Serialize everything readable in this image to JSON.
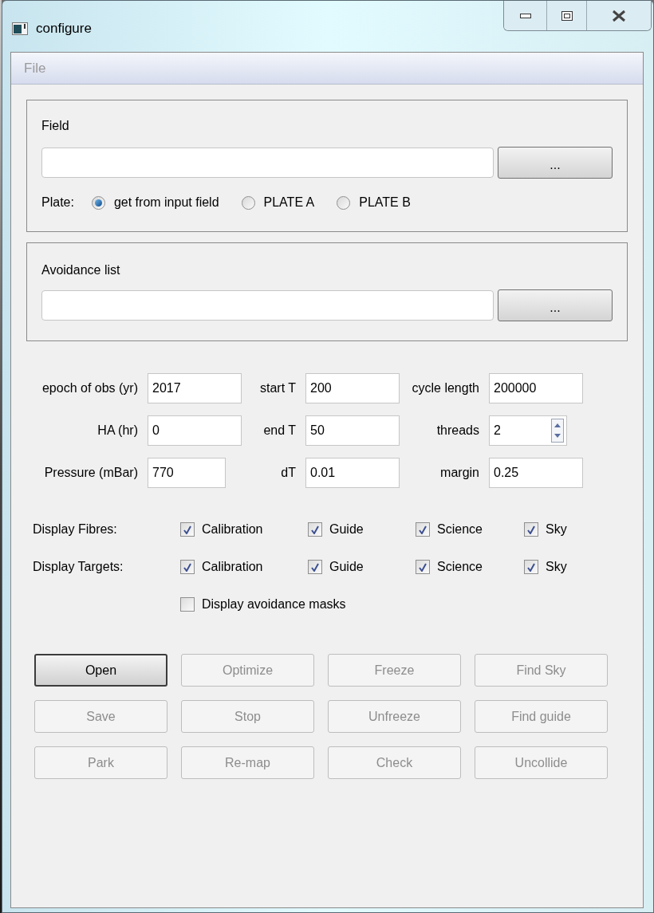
{
  "window": {
    "title": "configure"
  },
  "menu": [
    {
      "label": "File",
      "disabled": true
    }
  ],
  "field_group": {
    "title": "Field",
    "browse_button": "...",
    "plate": {
      "label": "Plate:",
      "options": [
        {
          "label": "get from input field",
          "selected": true
        },
        {
          "label": "PLATE A",
          "selected": false
        },
        {
          "label": "PLATE B",
          "selected": false
        }
      ]
    }
  },
  "avoidance_group": {
    "title": "Avoidance list",
    "browse_button": "..."
  },
  "parameters": [
    [
      {
        "label": "epoch of obs (yr)",
        "value": "2017",
        "kind": "text"
      },
      {
        "label": "start T",
        "value": "200",
        "kind": "text"
      },
      {
        "label": "cycle length",
        "value": "200000",
        "kind": "text"
      }
    ],
    [
      {
        "label": "HA (hr)",
        "value": "0",
        "kind": "text"
      },
      {
        "label": "end T",
        "value": "50",
        "kind": "text"
      },
      {
        "label": "threads",
        "value": "2",
        "kind": "spin"
      }
    ],
    [
      {
        "label": "Pressure (mBar)",
        "value": "770",
        "kind": "short"
      },
      {
        "label": "dT",
        "value": "0.01",
        "kind": "text"
      },
      {
        "label": "margin",
        "value": "0.25",
        "kind": "text"
      }
    ]
  ],
  "display_rows": [
    {
      "label": "Display Fibres:",
      "options": [
        {
          "label": "Calibration",
          "checked": true
        },
        {
          "label": "Guide",
          "checked": true
        },
        {
          "label": "Science",
          "checked": true
        },
        {
          "label": "Sky",
          "checked": true
        }
      ]
    },
    {
      "label": "Display Targets:",
      "options": [
        {
          "label": "Calibration",
          "checked": true
        },
        {
          "label": "Guide",
          "checked": true
        },
        {
          "label": "Science",
          "checked": true
        },
        {
          "label": "Sky",
          "checked": true
        }
      ]
    }
  ],
  "avoidance_masks": {
    "label": "Display avoidance masks",
    "checked": false
  },
  "buttons": [
    {
      "label": "Open",
      "disabled": false,
      "default": true
    },
    {
      "label": "Optimize",
      "disabled": true,
      "default": false
    },
    {
      "label": "Freeze",
      "disabled": true,
      "default": false
    },
    {
      "label": "Find Sky",
      "disabled": true,
      "default": false
    },
    {
      "label": "Save",
      "disabled": true,
      "default": false
    },
    {
      "label": "Stop",
      "disabled": true,
      "default": false
    },
    {
      "label": "Unfreeze",
      "disabled": true,
      "default": false
    },
    {
      "label": "Find guide",
      "disabled": true,
      "default": false
    },
    {
      "label": "Park",
      "disabled": true,
      "default": false
    },
    {
      "label": "Re-map",
      "disabled": true,
      "default": false
    },
    {
      "label": "Check",
      "disabled": true,
      "default": false
    },
    {
      "label": "Uncollide",
      "disabled": true,
      "default": false
    }
  ]
}
